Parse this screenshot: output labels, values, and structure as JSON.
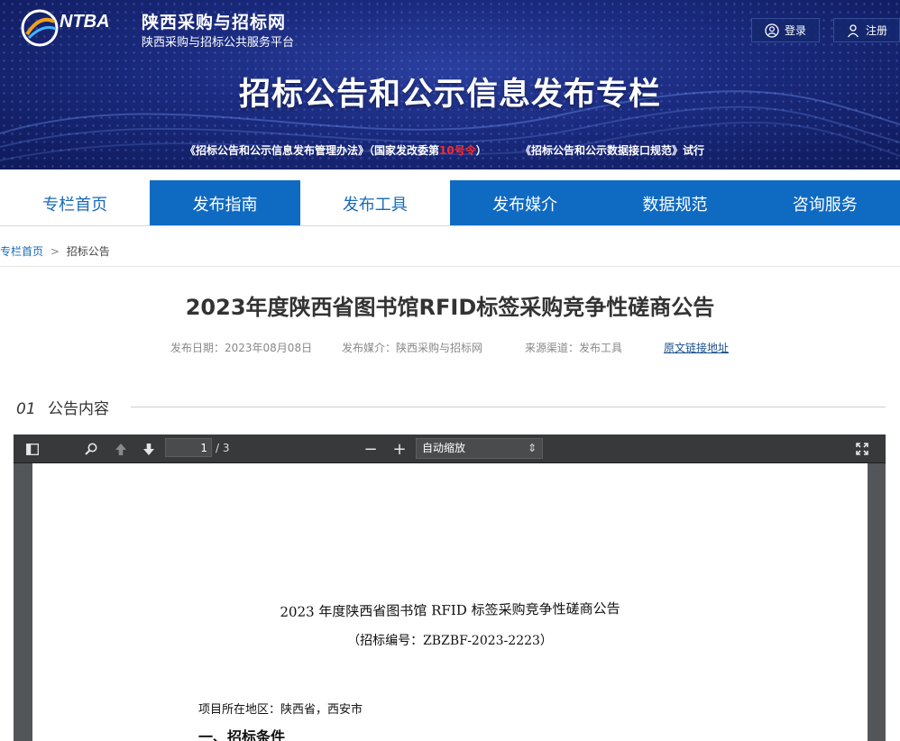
{
  "header": {
    "site_name": "陕西采购与招标网",
    "site_subtitle": "陕西采购与招标公共服务平台",
    "login_label": "登录",
    "register_label": "注册",
    "hero_title": "招标公告和公示信息发布专栏",
    "notice_prefix": "《招标公告和公示信息发布管理办法》（国家发改委第",
    "notice_red": "10号令",
    "notice_suffix": "）",
    "notice_2": "《招标公告和公示数据接口规范》试行"
  },
  "nav": {
    "items": [
      "专栏首页",
      "发布指南",
      "发布工具",
      "发布媒介",
      "数据规范",
      "咨询服务"
    ]
  },
  "breadcrumb": {
    "home": "专栏首页",
    "separator": ">",
    "current": "招标公告"
  },
  "article": {
    "title": "2023年度陕西省图书馆RFID标签采购竞争性磋商公告",
    "date": "发布日期：2023年08月08日",
    "media": "发布媒介：陕西采购与招标网",
    "source": "来源渠道：发布工具",
    "original_link": "原文链接地址"
  },
  "section": {
    "number": "01",
    "title": "公告内容"
  },
  "pdf_viewer": {
    "current_page": "1",
    "total_pages": "/ 3",
    "zoom_option": "自动缩放",
    "document": {
      "title": "2023 年度陕西省图书馆 RFID 标签采购竞争性磋商公告",
      "code": "（招标编号：ZBZBF-2023-2223）",
      "area": "项目所在地区：陕西省，西安市",
      "heading_1": "一、招标条件"
    }
  }
}
